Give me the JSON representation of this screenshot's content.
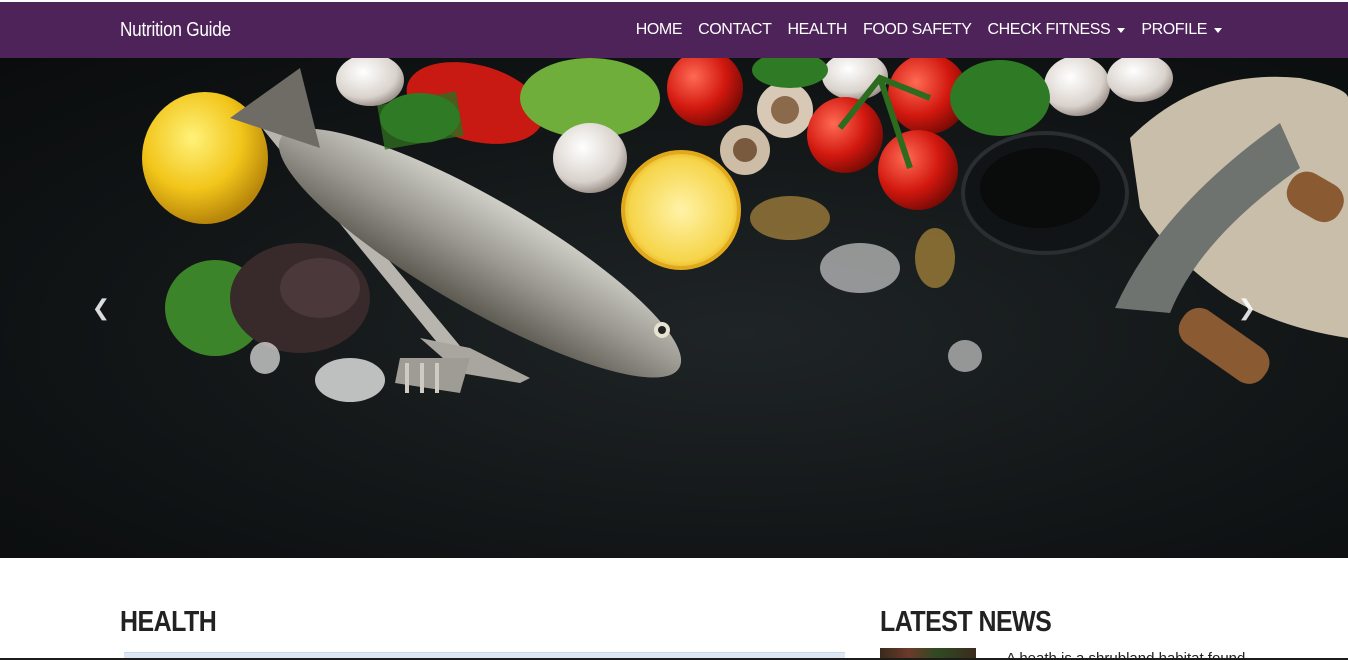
{
  "brand": "Nutrition Guide",
  "nav": {
    "items": [
      {
        "label": "HOME",
        "dropdown": false
      },
      {
        "label": "CONTACT",
        "dropdown": false
      },
      {
        "label": "HEALTH",
        "dropdown": false
      },
      {
        "label": "FOOD SAFETY",
        "dropdown": false
      },
      {
        "label": "CHECK FITNESS",
        "dropdown": true
      },
      {
        "label": "PROFILE",
        "dropdown": true
      }
    ]
  },
  "carousel": {
    "prev_icon": "chevron-left-icon",
    "next_icon": "chevron-right-icon",
    "prev_glyph": "❮",
    "next_glyph": "❯",
    "image": "fish, lemon, cutlery, tomatoes, garlic, mushrooms, peppers, herbs, oil bowl, mezzaluna knife on dark table"
  },
  "sections": {
    "health_title": "HEALTH",
    "news_title": "LATEST NEWS",
    "news_snippet": "A heath is a shrubland habitat found"
  },
  "colors": {
    "navbar_bg": "#4d235a",
    "nav_text": "#ffffff",
    "hero_bg": "#121617"
  }
}
